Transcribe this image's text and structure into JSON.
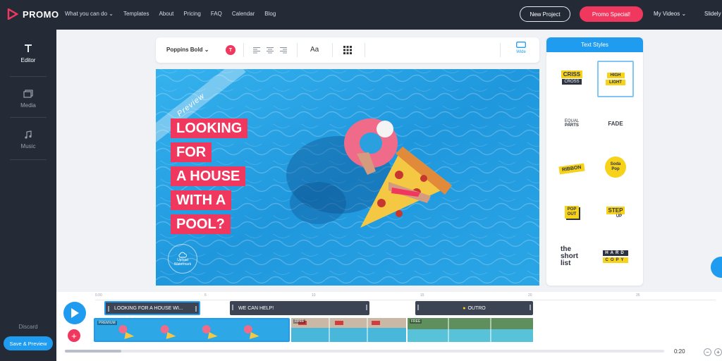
{
  "brand": {
    "name": "PROMO",
    "accent": "#f0385f",
    "primary": "#1f9bf0"
  },
  "nav": [
    "What you can do",
    "Templates",
    "About",
    "Pricing",
    "FAQ",
    "Calendar",
    "Blog"
  ],
  "header": {
    "new_project": "New Project",
    "promo_special": "Promo Special!",
    "my_videos": "My Videos",
    "user": "Slidely"
  },
  "sidebar": {
    "items": [
      {
        "label": "Editor",
        "icon": "text-icon",
        "active": true
      },
      {
        "label": "Media",
        "icon": "media-icon",
        "active": false
      },
      {
        "label": "Music",
        "icon": "music-icon",
        "active": false
      }
    ],
    "discard": "Discard",
    "save": "Save & Preview"
  },
  "toolbar": {
    "font": "Poppins Bold",
    "color_letter": "T",
    "aa": "Aa",
    "wide": "Wide"
  },
  "canvas": {
    "preview": "Preview",
    "headline": [
      "LOOKING",
      "FOR",
      "A HOUSE",
      "WITH A",
      "POOL?"
    ],
    "upload_watermark": "Upload Watermark"
  },
  "text_styles": {
    "title": "Text Styles",
    "items": [
      {
        "lines": [
          "CRISS",
          "CROSS"
        ],
        "name": "criss-cross"
      },
      {
        "lines": [
          "HIGH",
          "LIGHT"
        ],
        "name": "highlight"
      },
      {
        "lines": [
          "EQUAL",
          "PARTS"
        ],
        "name": "equal-parts"
      },
      {
        "lines": [
          "FADE"
        ],
        "name": "fade"
      },
      {
        "lines": [
          "RIBBON"
        ],
        "name": "ribbon"
      },
      {
        "lines": [
          "Soda",
          "Pop"
        ],
        "name": "soda-pop"
      },
      {
        "lines": [
          "POP",
          "OUT"
        ],
        "name": "pop-out"
      },
      {
        "lines": [
          "STEP",
          "UP"
        ],
        "name": "step-up"
      },
      {
        "lines": [
          "the",
          "short",
          "list"
        ],
        "name": "the-short-list"
      },
      {
        "lines": [
          "HARD",
          "COPY"
        ],
        "name": "hard-copy"
      }
    ]
  },
  "timeline": {
    "ruler": [
      "0.00",
      "5",
      "10",
      "15",
      "20",
      "25"
    ],
    "clips": [
      {
        "label": "LOOKING FOR A HOUSE WI...",
        "selected": true
      },
      {
        "label": "WE CAN HELP!",
        "selected": false
      },
      {
        "label": "OUTRO",
        "selected": false
      }
    ],
    "strip_tags": [
      "PREMIUM",
      "FREE",
      "FREE"
    ],
    "duration": "0:20",
    "zoom_out": "−",
    "zoom_in": "+"
  }
}
